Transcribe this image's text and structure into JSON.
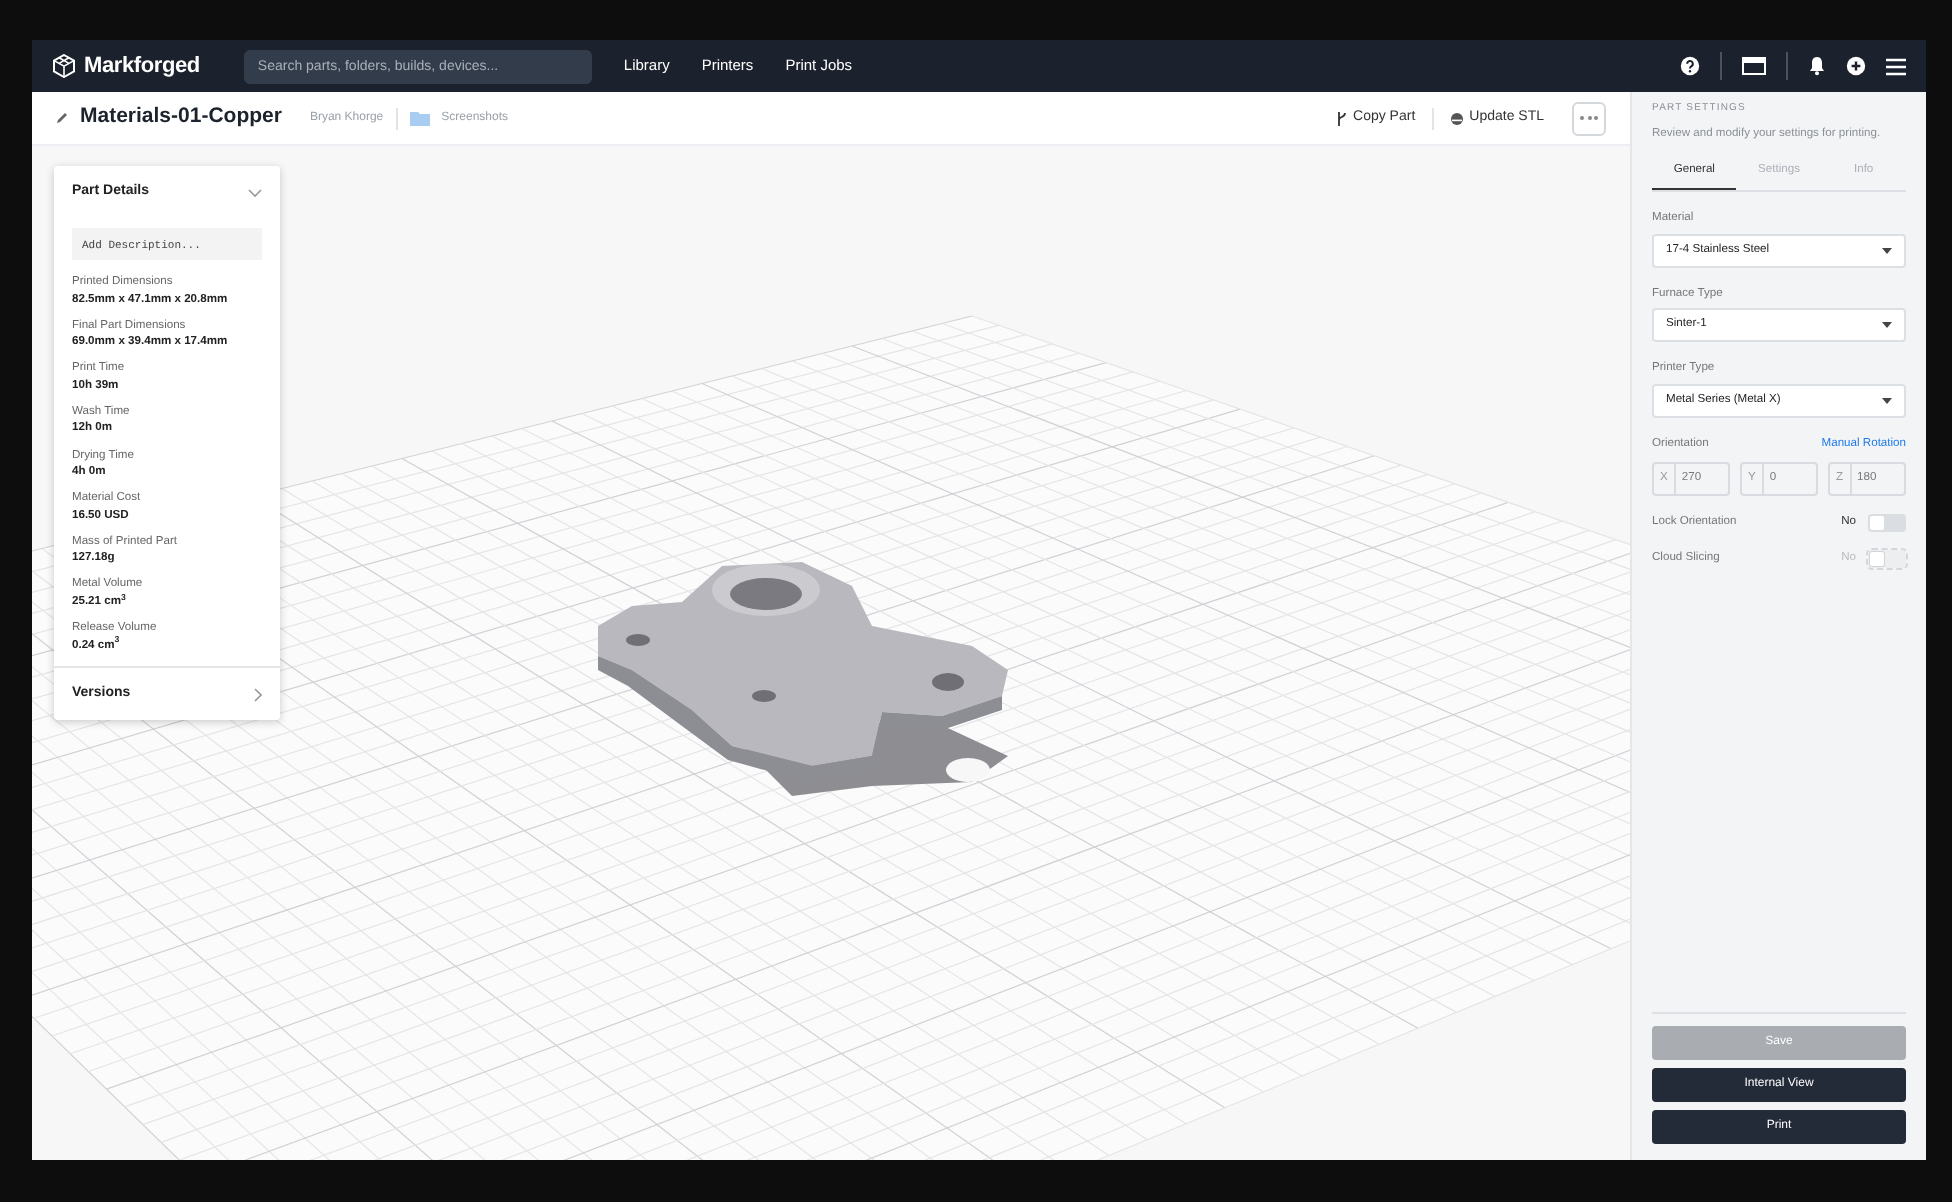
{
  "app_bar": {
    "logo": "Markforged",
    "search": {
      "placeholder": "Search parts, folders, builds, devices..."
    },
    "nav_links": [
      "Library",
      "Printers",
      "Print Jobs"
    ]
  },
  "part_header": {
    "title": "Materials-01-Copper",
    "owner": "Bryan Khorge",
    "folder": "Screenshots",
    "actions": [
      {
        "kind": "copy",
        "label": "Copy Part"
      },
      {
        "kind": "update",
        "label": "Update STL"
      }
    ]
  },
  "details_panel": {
    "title": "Part Details",
    "expanded": true,
    "description": {
      "placeholder": "Add Description..."
    },
    "fields": [
      {
        "label": "Printed Dimensions",
        "value": "82.5mm x 47.1mm x 20.8mm"
      },
      {
        "label": "Final Part Dimensions",
        "value": "69.0mm x 39.4mm x 17.4mm"
      },
      {
        "label": "Print Time",
        "value": "10h 39m"
      },
      {
        "label": "Wash Time",
        "value": "12h 0m"
      },
      {
        "label": "Drying Time",
        "value": "4h 0m"
      },
      {
        "label": "Material Cost",
        "value": "16.50 USD"
      },
      {
        "label": "Mass of Printed Part",
        "value": "127.18g"
      },
      {
        "label": "Metal Volume",
        "value": "25.21 cm$^{3}$"
      },
      {
        "label": "Release Volume",
        "value": "0.24 cm$^{3}$"
      }
    ],
    "versions": "Versions"
  },
  "settings_panel": {
    "heading": "PART SETTINGS",
    "subtitle": "Review and modify your settings for printing.",
    "tabs": [
      {
        "label": "General",
        "selected": true
      },
      {
        "label": "Settings",
        "selected": false
      },
      {
        "label": "Info",
        "selected": false
      }
    ],
    "selects": [
      {
        "label": "Material",
        "value": "17-4 Stainless Steel"
      },
      {
        "label": "Furnace Type",
        "value": "Sinter-1"
      },
      {
        "label": "Printer Type",
        "value": "Metal Series (Metal X)"
      }
    ],
    "orientation": {
      "label": "Orientation",
      "link": "Manual Rotation",
      "disabled": true,
      "axes": [
        {
          "axis": "X",
          "value": "270"
        },
        {
          "axis": "Y",
          "value": "0"
        },
        {
          "axis": "Z",
          "value": "180"
        }
      ]
    },
    "toggles": [
      {
        "label": "Lock Orientation",
        "state_text": "No",
        "on": false,
        "disabled": false
      },
      {
        "label": "Cloud Slicing",
        "state_text": "No",
        "on": false,
        "disabled": true
      }
    ],
    "buttons": [
      {
        "label": "Save",
        "disabled": true
      },
      {
        "label": "Internal View",
        "disabled": false
      },
      {
        "label": "Print",
        "disabled": false
      }
    ]
  }
}
